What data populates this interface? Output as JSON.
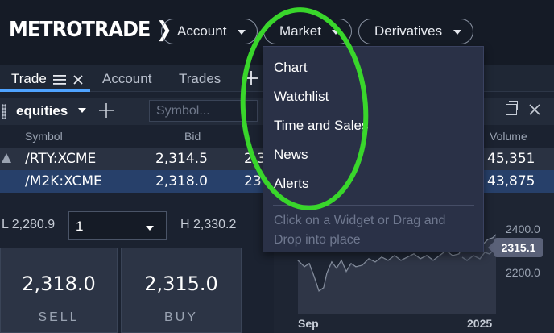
{
  "header": {
    "logo": "METROTRADE ❯",
    "nav": [
      {
        "label": "Account"
      },
      {
        "label": "Market"
      },
      {
        "label": "Derivatives"
      }
    ]
  },
  "tabs": [
    {
      "label": "Trade"
    },
    {
      "label": "Account"
    },
    {
      "label": "Trades"
    }
  ],
  "toolbar": {
    "watchlist": "equities",
    "symbol_placeholder": "Symbol..."
  },
  "table": {
    "headers": {
      "symbol": "Symbol",
      "bid": "Bid",
      "volume": "Volume"
    },
    "rows": [
      {
        "symbol": "/RTY:XCME",
        "bid": "2,314.5",
        "partial": "2,3",
        "volume": "45,351"
      },
      {
        "symbol": "/M2K:XCME",
        "bid": "2,318.0",
        "partial": "23",
        "volume": "43,875"
      }
    ]
  },
  "order": {
    "low": "L 2,280.9",
    "high": "H 2,330.2",
    "quantity": "1",
    "sell_price": "2,318.0",
    "sell_label": "SELL",
    "buy_price": "2,315.0",
    "buy_label": "BUY"
  },
  "chart": {
    "y_labels": [
      "2400.0",
      "2200.0"
    ],
    "price_tag": "2315.1",
    "x_labels": [
      "Sep",
      "2025"
    ]
  },
  "menu": {
    "items": [
      "Chart",
      "Watchlist",
      "Time and Sales",
      "News",
      "Alerts"
    ],
    "hint": "Click on a Widget or Drag and Drop into place"
  },
  "colors": {
    "accent": "#4fa3ff",
    "annotation": "#39d62b",
    "selected_row": "#27406a"
  }
}
